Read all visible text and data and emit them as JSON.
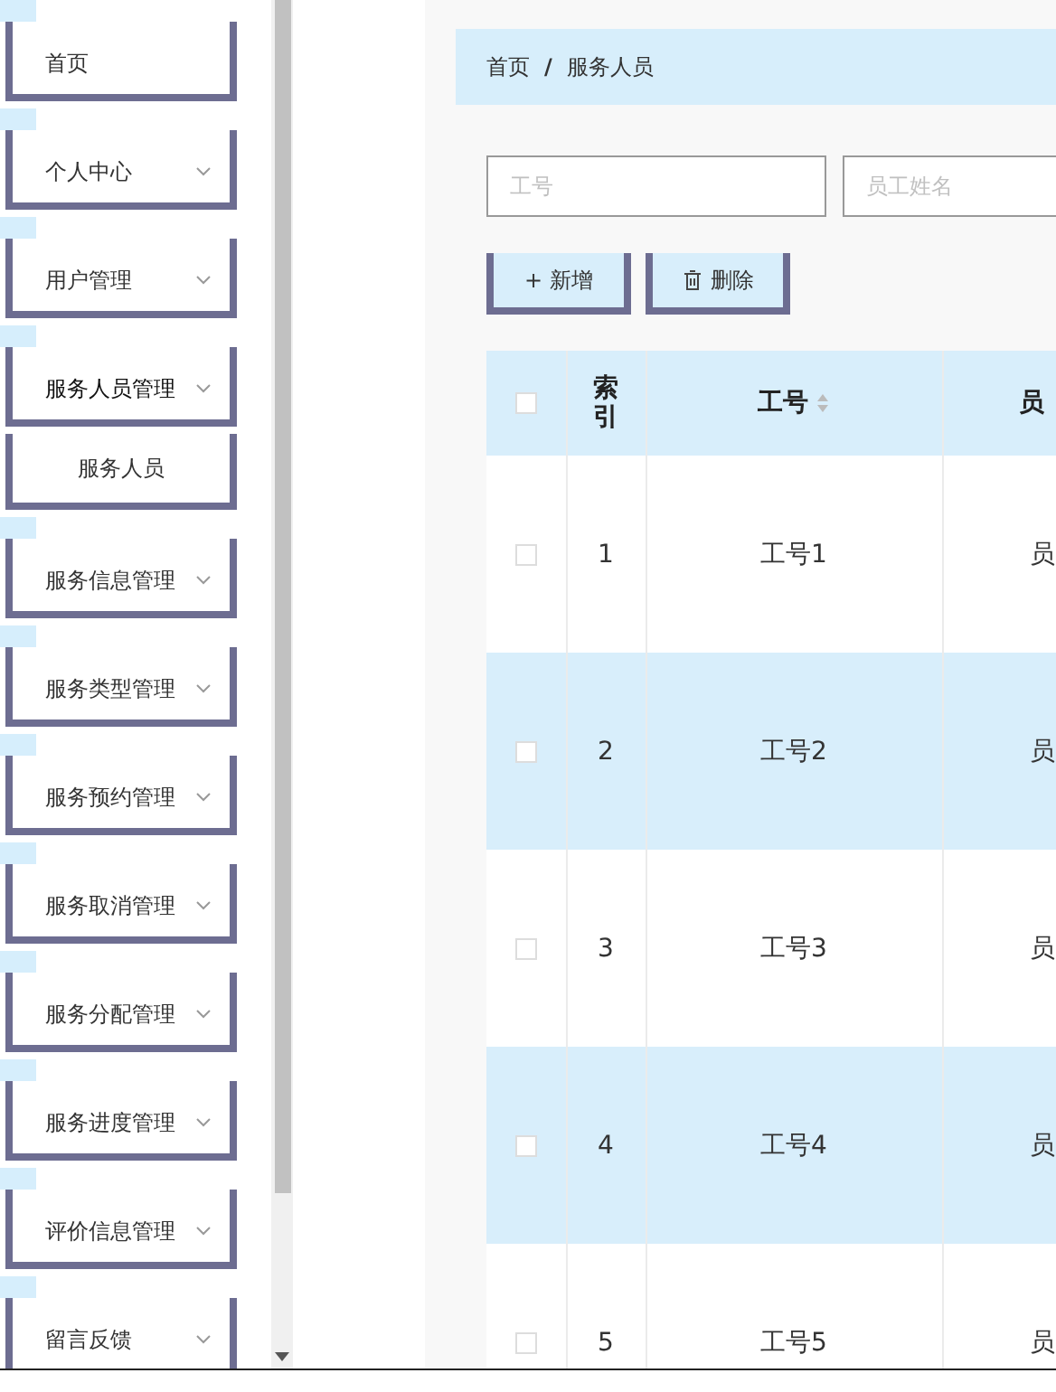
{
  "sidebar": {
    "items": [
      {
        "label": "首页",
        "kind": "link"
      },
      {
        "label": "个人中心",
        "kind": "group",
        "expanded": false
      },
      {
        "label": "用户管理",
        "kind": "group",
        "expanded": false
      },
      {
        "label": "服务人员管理",
        "kind": "group",
        "expanded": true,
        "children": [
          {
            "label": "服务人员",
            "kind": "sub"
          }
        ]
      },
      {
        "label": "服务信息管理",
        "kind": "group",
        "expanded": false
      },
      {
        "label": "服务类型管理",
        "kind": "group",
        "expanded": false
      },
      {
        "label": "服务预约管理",
        "kind": "group",
        "expanded": false
      },
      {
        "label": "服务取消管理",
        "kind": "group",
        "expanded": false
      },
      {
        "label": "服务分配管理",
        "kind": "group",
        "expanded": false
      },
      {
        "label": "服务进度管理",
        "kind": "group",
        "expanded": false
      },
      {
        "label": "评价信息管理",
        "kind": "group",
        "expanded": false
      },
      {
        "label": "留言反馈",
        "kind": "group",
        "expanded": false
      }
    ]
  },
  "breadcrumb": [
    "首页",
    "服务人员"
  ],
  "breadcrumb_separator": "/",
  "search": [
    {
      "placeholder": "工号"
    },
    {
      "placeholder": "员工姓名"
    }
  ],
  "buttons": [
    {
      "kind": "add",
      "label": "新增",
      "icon": "+"
    },
    {
      "kind": "delete",
      "label": "删除"
    }
  ],
  "table": {
    "columns": [
      "索引",
      "工号",
      "员"
    ],
    "header_checked": false,
    "rows": [
      {
        "checked": false,
        "cells": [
          "1",
          "工号1",
          "员"
        ]
      },
      {
        "checked": false,
        "cells": [
          "2",
          "工号2",
          "员"
        ]
      },
      {
        "checked": false,
        "cells": [
          "3",
          "工号3",
          "员"
        ]
      },
      {
        "checked": false,
        "cells": [
          "4",
          "工号4",
          "员"
        ]
      },
      {
        "checked": false,
        "cells": [
          "5",
          "工号5",
          "员"
        ]
      }
    ]
  }
}
